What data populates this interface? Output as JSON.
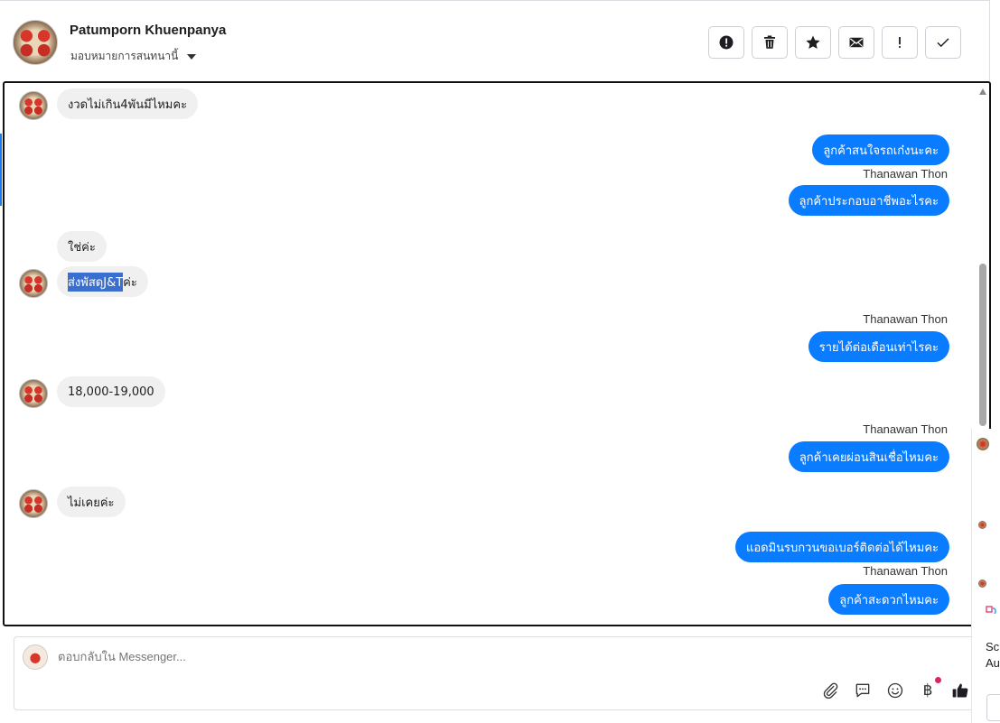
{
  "header": {
    "contact_name": "Patumporn Khuenpanya",
    "assign_label": "มอบหมายการสนทนานี้",
    "actions": [
      {
        "name": "spam",
        "icon": "alert-circle-icon"
      },
      {
        "name": "delete",
        "icon": "trash-icon"
      },
      {
        "name": "star",
        "icon": "star-icon"
      },
      {
        "name": "unread",
        "icon": "envelope-icon"
      },
      {
        "name": "follow-up",
        "icon": "exclamation-icon"
      },
      {
        "name": "done",
        "icon": "check-icon"
      }
    ]
  },
  "messages": [
    {
      "dir": "in",
      "text": "งวดไม่เกิน4พันมีไหมคะ",
      "avatar": true
    },
    {
      "dir": "out",
      "text": "ลูกค้าสนใจรถเก๋งนะคะ"
    },
    {
      "dir": "out",
      "sender": "Thanawan Thon",
      "text": "ลูกค้าประกอบอาชีพอะไรคะ"
    },
    {
      "dir": "in",
      "text": "ใช่ค่ะ",
      "avatar": false
    },
    {
      "dir": "in",
      "text_highlight": "ส่งพัสดุJ&T",
      "text_rest": "ค่ะ",
      "avatar": true
    },
    {
      "dir": "out",
      "sender": "Thanawan Thon",
      "text": "รายได้ต่อเดือนเท่าไรคะ"
    },
    {
      "dir": "in",
      "text": "18,000-19,000",
      "avatar": true
    },
    {
      "dir": "out",
      "sender": "Thanawan Thon",
      "text": "ลูกค้าเคยผ่อนสินเชื่อไหมคะ"
    },
    {
      "dir": "in",
      "text": "ไม่เคยค่ะ",
      "avatar": true
    },
    {
      "dir": "out",
      "text": "แอดมินรบกวนขอเบอร์ติดต่อได้ไหมคะ"
    },
    {
      "dir": "out",
      "sender": "Thanawan Thon",
      "text": "ลูกค้าสะดวกไหมคะ"
    }
  ],
  "composer": {
    "placeholder": "ตอบกลับใน Messenger...",
    "tools": [
      "paperclip-icon",
      "speech-bubble-icon",
      "smiley-icon",
      "baht-icon",
      "thumbs-up-icon"
    ],
    "baht_symbol": "฿"
  },
  "side_panel": {
    "big_line_1": "Scr",
    "big_line_2": "Au"
  },
  "colors": {
    "outgoing_bubble": "#0a7cff",
    "incoming_bubble": "#f0f0f0"
  }
}
